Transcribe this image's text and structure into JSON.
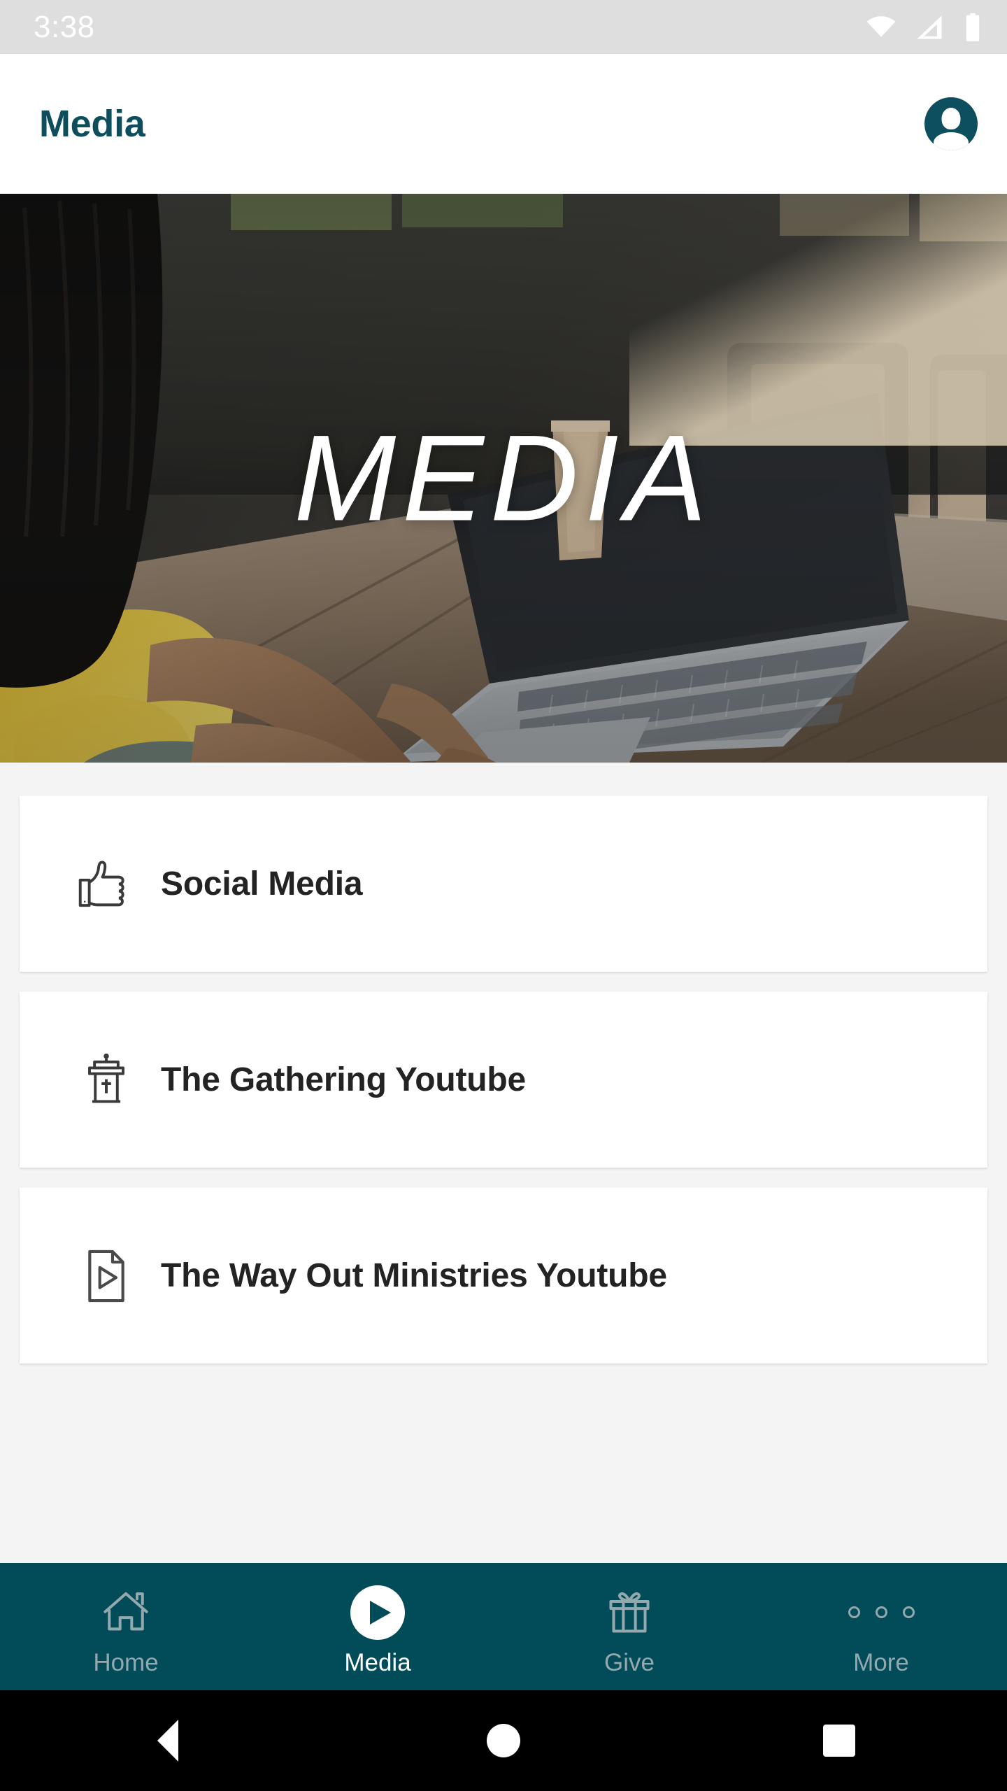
{
  "status_bar": {
    "time": "3:38",
    "icons": [
      "wifi-icon",
      "cellular-signal-icon",
      "battery-icon"
    ],
    "background": "#dedede",
    "foreground": "#ffffff"
  },
  "app_bar": {
    "title": "Media",
    "title_color": "#0d4d5c",
    "avatar_icon": "account-circle-icon",
    "avatar_color": "#0d4f5e"
  },
  "hero": {
    "overlay_text": "MEDIA",
    "description": "Person in a yellow shirt typing on a laptop at a wooden table",
    "text_color": "#ffffff"
  },
  "list": {
    "items": [
      {
        "label": "Social Media",
        "icon": "thumbs-up-icon"
      },
      {
        "label": "The Gathering Youtube",
        "icon": "pulpit-icon"
      },
      {
        "label": "The Way Out Ministries Youtube",
        "icon": "video-file-icon"
      }
    ]
  },
  "bottom_nav": {
    "background": "#024b59",
    "active_color": "#ffffff",
    "inactive_color": "#93a9ad",
    "items": [
      {
        "label": "Home",
        "icon": "home-icon",
        "active": false
      },
      {
        "label": "Media",
        "icon": "play-circle-icon",
        "active": true
      },
      {
        "label": "Give",
        "icon": "gift-icon",
        "active": false
      },
      {
        "label": "More",
        "icon": "more-dots-icon",
        "active": false
      }
    ]
  },
  "android_nav": {
    "background": "#000000",
    "buttons": [
      "back-icon",
      "home-icon",
      "recents-icon"
    ]
  }
}
